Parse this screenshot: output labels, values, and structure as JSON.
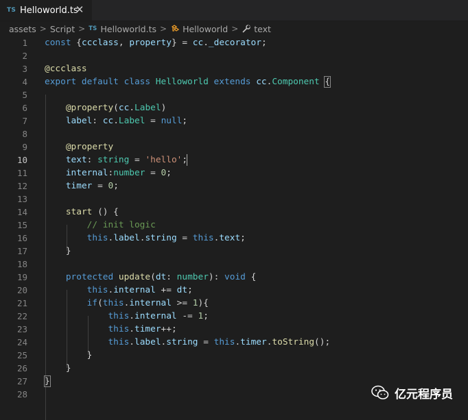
{
  "tab": {
    "badge": "TS",
    "title": "Helloworld.ts",
    "close": "✕"
  },
  "breadcrumb": {
    "items": [
      "assets",
      "Script",
      "Helloworld.ts",
      "Helloworld",
      "text"
    ],
    "ts_badge": "TS",
    "separator": ">"
  },
  "editor": {
    "active_line": 10,
    "line_numbers": [
      "1",
      "2",
      "3",
      "4",
      "5",
      "6",
      "7",
      "8",
      "9",
      "10",
      "11",
      "12",
      "13",
      "14",
      "15",
      "16",
      "17",
      "18",
      "19",
      "20",
      "21",
      "22",
      "23",
      "24",
      "25",
      "26",
      "27",
      "28"
    ],
    "lines": [
      [
        [
          "k",
          "const "
        ],
        [
          "p",
          "{"
        ],
        [
          "v",
          "ccclass"
        ],
        [
          "p",
          ", "
        ],
        [
          "v",
          "property"
        ],
        [
          "p",
          "} = "
        ],
        [
          "v",
          "cc"
        ],
        [
          "p",
          "."
        ],
        [
          "v",
          "_decorator"
        ],
        [
          "p",
          ";"
        ]
      ],
      [],
      [
        [
          "fn",
          "@ccclass"
        ]
      ],
      [
        [
          "k",
          "export default class "
        ],
        [
          "f",
          "Helloworld "
        ],
        [
          "k",
          "extends "
        ],
        [
          "v",
          "cc"
        ],
        [
          "p",
          "."
        ],
        [
          "f",
          "Component "
        ],
        [
          "p",
          "{"
        ]
      ],
      [],
      [
        [
          "p",
          "    "
        ],
        [
          "fn",
          "@property"
        ],
        [
          "p",
          "("
        ],
        [
          "v",
          "cc"
        ],
        [
          "p",
          "."
        ],
        [
          "f",
          "Label"
        ],
        [
          "p",
          ")"
        ]
      ],
      [
        [
          "p",
          "    "
        ],
        [
          "v",
          "label"
        ],
        [
          "p",
          ": "
        ],
        [
          "v",
          "cc"
        ],
        [
          "p",
          "."
        ],
        [
          "f",
          "Label"
        ],
        [
          "p",
          " = "
        ],
        [
          "k",
          "null"
        ],
        [
          "p",
          ";"
        ]
      ],
      [],
      [
        [
          "p",
          "    "
        ],
        [
          "fn",
          "@property"
        ]
      ],
      [
        [
          "p",
          "    "
        ],
        [
          "v",
          "text"
        ],
        [
          "p",
          ": "
        ],
        [
          "f",
          "string"
        ],
        [
          "p",
          " = "
        ],
        [
          "s",
          "'hello'"
        ],
        [
          "p",
          ";"
        ]
      ],
      [
        [
          "p",
          "    "
        ],
        [
          "v",
          "internal"
        ],
        [
          "p",
          ":"
        ],
        [
          "f",
          "number"
        ],
        [
          "p",
          " = "
        ],
        [
          "n",
          "0"
        ],
        [
          "p",
          ";"
        ]
      ],
      [
        [
          "p",
          "    "
        ],
        [
          "v",
          "timer"
        ],
        [
          "p",
          " = "
        ],
        [
          "n",
          "0"
        ],
        [
          "p",
          ";"
        ]
      ],
      [],
      [
        [
          "p",
          "    "
        ],
        [
          "fn",
          "start"
        ],
        [
          "p",
          " () {"
        ]
      ],
      [
        [
          "p",
          "        "
        ],
        [
          "c",
          "// init logic"
        ]
      ],
      [
        [
          "p",
          "        "
        ],
        [
          "k",
          "this"
        ],
        [
          "p",
          "."
        ],
        [
          "v",
          "label"
        ],
        [
          "p",
          "."
        ],
        [
          "v",
          "string"
        ],
        [
          "p",
          " = "
        ],
        [
          "k",
          "this"
        ],
        [
          "p",
          "."
        ],
        [
          "v",
          "text"
        ],
        [
          "p",
          ";"
        ]
      ],
      [
        [
          "p",
          "    }"
        ]
      ],
      [],
      [
        [
          "p",
          "    "
        ],
        [
          "k",
          "protected "
        ],
        [
          "fn",
          "update"
        ],
        [
          "p",
          "("
        ],
        [
          "v",
          "dt"
        ],
        [
          "p",
          ": "
        ],
        [
          "f",
          "number"
        ],
        [
          "p",
          "): "
        ],
        [
          "k",
          "void"
        ],
        [
          "p",
          " {"
        ]
      ],
      [
        [
          "p",
          "        "
        ],
        [
          "k",
          "this"
        ],
        [
          "p",
          "."
        ],
        [
          "v",
          "internal"
        ],
        [
          "p",
          " += "
        ],
        [
          "v",
          "dt"
        ],
        [
          "p",
          ";"
        ]
      ],
      [
        [
          "p",
          "        "
        ],
        [
          "k",
          "if"
        ],
        [
          "p",
          "("
        ],
        [
          "k",
          "this"
        ],
        [
          "p",
          "."
        ],
        [
          "v",
          "internal"
        ],
        [
          "p",
          " >= "
        ],
        [
          "n",
          "1"
        ],
        [
          "p",
          "){"
        ]
      ],
      [
        [
          "p",
          "            "
        ],
        [
          "k",
          "this"
        ],
        [
          "p",
          "."
        ],
        [
          "v",
          "internal"
        ],
        [
          "p",
          " -= "
        ],
        [
          "n",
          "1"
        ],
        [
          "p",
          ";"
        ]
      ],
      [
        [
          "p",
          "            "
        ],
        [
          "k",
          "this"
        ],
        [
          "p",
          "."
        ],
        [
          "v",
          "timer"
        ],
        [
          "p",
          "++;"
        ]
      ],
      [
        [
          "p",
          "            "
        ],
        [
          "k",
          "this"
        ],
        [
          "p",
          "."
        ],
        [
          "v",
          "label"
        ],
        [
          "p",
          "."
        ],
        [
          "v",
          "string"
        ],
        [
          "p",
          " = "
        ],
        [
          "k",
          "this"
        ],
        [
          "p",
          "."
        ],
        [
          "v",
          "timer"
        ],
        [
          "p",
          "."
        ],
        [
          "fn",
          "toString"
        ],
        [
          "p",
          "();"
        ]
      ],
      [
        [
          "p",
          "        }"
        ]
      ],
      [
        [
          "p",
          "    }"
        ]
      ],
      [
        [
          "p",
          "}"
        ]
      ],
      []
    ]
  },
  "colors": {
    "background": "#1e1e1e",
    "keyword": "#569cd6",
    "type": "#4ec9b0",
    "variable": "#9cdcfe",
    "function": "#dcdcaa",
    "string": "#ce9178",
    "number": "#b5cea8",
    "comment": "#6a9955"
  },
  "watermark": {
    "text": "亿元程序员",
    "icon": "wechat-icon"
  }
}
